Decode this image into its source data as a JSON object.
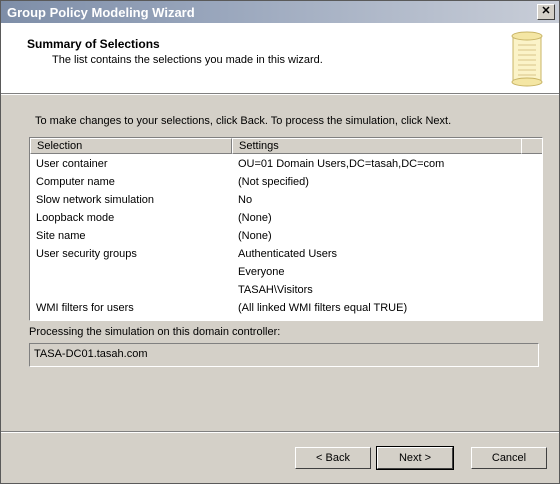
{
  "window": {
    "title": "Group Policy Modeling Wizard",
    "close_glyph": "✕"
  },
  "header": {
    "title": "Summary of Selections",
    "subtitle": "The list contains the selections you made in this wizard.",
    "icon": "scroll-icon"
  },
  "instruction": "To make changes to your selections, click Back. To process the simulation, click Next.",
  "list": {
    "columns": [
      "Selection",
      "Settings"
    ],
    "rows": [
      [
        "User container",
        "OU=01 Domain Users,DC=tasah,DC=com"
      ],
      [
        "Computer name",
        "(Not specified)"
      ],
      [
        "Slow network simulation",
        "No"
      ],
      [
        "Loopback mode",
        "(None)"
      ],
      [
        "Site name",
        "(None)"
      ],
      [
        "User security groups",
        "Authenticated Users"
      ],
      [
        "",
        "Everyone"
      ],
      [
        "",
        "TASAH\\Visitors"
      ],
      [
        "WMI filters for users",
        "(All linked WMI filters equal TRUE)"
      ]
    ]
  },
  "domain_controller": {
    "label": "Processing the simulation on this domain controller:",
    "value": "TASA-DC01.tasah.com"
  },
  "buttons": {
    "back": "< Back",
    "next": "Next >",
    "cancel": "Cancel"
  },
  "colors": {
    "dialog_bg": "#d4d0c8",
    "title_bar": "#9aa7bd",
    "content_bg": "#ffffff"
  }
}
